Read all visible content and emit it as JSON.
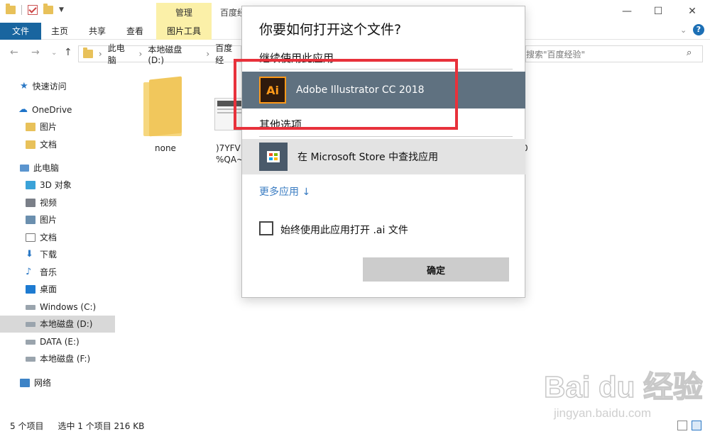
{
  "window": {
    "title": "百度经验",
    "manage_tab": "管理",
    "minimize": "—",
    "maximize": "☐",
    "close": "✕"
  },
  "ribbon": {
    "file": "文件",
    "tabs": [
      "主页",
      "共享",
      "查看"
    ],
    "picture_tools": "图片工具"
  },
  "address": {
    "path": [
      "此电脑",
      "本地磁盘 (D:)",
      "百度经"
    ],
    "search_placeholder": "搜索\"百度经验\""
  },
  "sidebar": {
    "items": [
      {
        "label": "快速访问",
        "icon": "star-icon"
      },
      {
        "label": "OneDrive",
        "icon": "cloud-icon"
      },
      {
        "label": "图片",
        "icon": "folder-icon"
      },
      {
        "label": "文档",
        "icon": "folder-icon"
      },
      {
        "label": "此电脑",
        "icon": "computer-icon"
      },
      {
        "label": "3D 对象",
        "icon": "cube-icon"
      },
      {
        "label": "视频",
        "icon": "video-icon"
      },
      {
        "label": "图片",
        "icon": "pictures-icon"
      },
      {
        "label": "文档",
        "icon": "documents-icon"
      },
      {
        "label": "下载",
        "icon": "download-icon"
      },
      {
        "label": "音乐",
        "icon": "music-icon"
      },
      {
        "label": "桌面",
        "icon": "desktop-icon"
      },
      {
        "label": "Windows (C:)",
        "icon": "drive-icon"
      },
      {
        "label": "本地磁盘 (D:)",
        "icon": "drive-icon",
        "selected": true
      },
      {
        "label": "DATA (E:)",
        "icon": "drive-icon"
      },
      {
        "label": "本地磁盘 (F:)",
        "icon": "drive-icon"
      },
      {
        "label": "网络",
        "icon": "network-icon"
      }
    ]
  },
  "files": {
    "folder_name": "none",
    "file2_line1": ")7YFV",
    "file2_line2": "%QA~",
    "file3_tail": "0"
  },
  "status": {
    "count": "5 个项目",
    "selection": "选中 1 个项目  216 KB"
  },
  "dialog": {
    "title": "你要如何打开这个文件?",
    "keep_using": "继续使用此应用",
    "ai_app": "Adobe Illustrator CC 2018",
    "ai_icon_text": "Ai",
    "other_options": "其他选项",
    "store_app": "在 Microsoft Store 中查找应用",
    "more_apps": "更多应用 ↓",
    "always_use": "始终使用此应用打开 .ai 文件",
    "ok": "确定"
  },
  "watermark": {
    "brand": "Bai du 经验",
    "url": "jingyan.baidu.com"
  },
  "colors": {
    "accent": "#19659f",
    "selected_app_row": "#5f7180",
    "highlight": "#e8313b",
    "manage_tab": "#fbf0a8"
  }
}
